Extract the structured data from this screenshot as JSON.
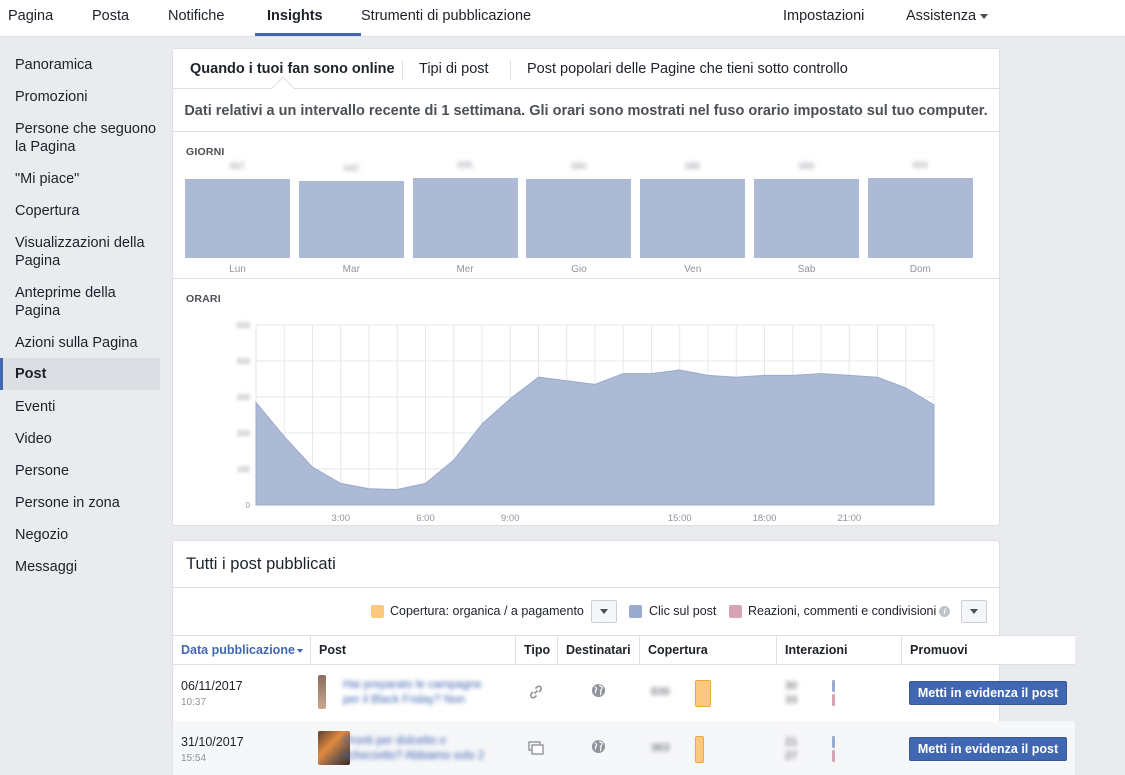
{
  "topnav": {
    "items": [
      "Pagina",
      "Posta",
      "Notifiche",
      "Insights",
      "Strumenti di pubblicazione"
    ],
    "settings": "Impostazioni",
    "help": "Assistenza"
  },
  "sidebar": {
    "items": [
      "Panoramica",
      "Promozioni",
      "Persone che seguono la Pagina",
      "\"Mi piace\"",
      "Copertura",
      "Visualizzazioni della Pagina",
      "Anteprime della Pagina",
      "Azioni sulla Pagina",
      "Post",
      "Eventi",
      "Video",
      "Persone",
      "Persone in zona",
      "Negozio",
      "Messaggi"
    ],
    "active": "Post"
  },
  "insights": {
    "tabs": [
      "Quando i tuoi fan sono online",
      "Tipi di post",
      "Post popolari delle Pagine che tieni sotto controllo"
    ],
    "note": "Dati relativi a un intervallo recente di 1 settimana. Gli orari sono mostrati nel fuso orario impostato sul tuo computer.",
    "days_label": "GIORNI",
    "hours_label": "ORARI"
  },
  "colors": {
    "accent": "#4267b2",
    "bar_fill": "#adbad6",
    "reach_organic": "#fbc97e",
    "post_clicks": "#9aabd1",
    "reactions": "#d7a3b6"
  },
  "chart_data": [
    {
      "type": "bar",
      "categories": [
        "Lun",
        "Mar",
        "Mer",
        "Gio",
        "Ven",
        "Sab",
        "Dom"
      ],
      "values": [
        79,
        77,
        80,
        79,
        79,
        79,
        80
      ],
      "value_labels": [
        "667",
        "642",
        "695",
        "684",
        "686",
        "689",
        "694"
      ]
    },
    {
      "type": "area",
      "x": [
        0,
        1,
        2,
        3,
        4,
        5,
        6,
        7,
        8,
        9,
        10,
        11,
        12,
        13,
        14,
        15,
        16,
        17,
        18,
        19,
        20,
        21,
        22,
        23,
        24
      ],
      "values": [
        285,
        190,
        105,
        60,
        45,
        43,
        60,
        125,
        225,
        295,
        355,
        345,
        335,
        365,
        365,
        375,
        360,
        355,
        360,
        360,
        365,
        360,
        355,
        325,
        278
      ],
      "yticks": [
        0,
        100,
        200,
        300,
        400,
        500
      ],
      "xtick_labels": [
        [
          "3",
          "3:00"
        ],
        [
          "6",
          "6:00"
        ],
        [
          "9",
          "9:00"
        ],
        [
          "15",
          "15:00"
        ],
        [
          "18",
          "18:00"
        ],
        [
          "21",
          "21:00"
        ]
      ],
      "ylim": [
        0,
        500
      ],
      "xlim": [
        0,
        24
      ],
      "grid": true
    }
  ],
  "posts": {
    "title": "Tutti i post pubblicati",
    "legend": {
      "reach": "Copertura: organica / a pagamento",
      "clicks": "Clic sul post",
      "reactions": "Reazioni, commenti e condivisioni"
    },
    "columns": [
      "Data pubblicazione",
      "Post",
      "Tipo",
      "Destinatari",
      "Copertura",
      "Interazioni",
      "Promuovi"
    ],
    "rows": [
      {
        "date": "06/11/2017",
        "time": "10:37",
        "text": "Hai preparato le campagne per il Black Friday? Non",
        "type_icon": "link-icon",
        "audience_icon": "globe-icon",
        "reach": "839",
        "reach_level": 0.85,
        "clicks": "30",
        "reactions": "33",
        "promote": "Metti in evidenza il post"
      },
      {
        "date": "31/10/2017",
        "time": "15:54",
        "text": "Pronti per dolcetto o scherzetto? Abbiamo solo 2",
        "type_icon": "album-icon",
        "audience_icon": "globe-icon",
        "reach": "363",
        "reach_level": 0.85,
        "clicks": "21",
        "reactions": "27",
        "promote": "Metti in evidenza il post"
      }
    ]
  }
}
